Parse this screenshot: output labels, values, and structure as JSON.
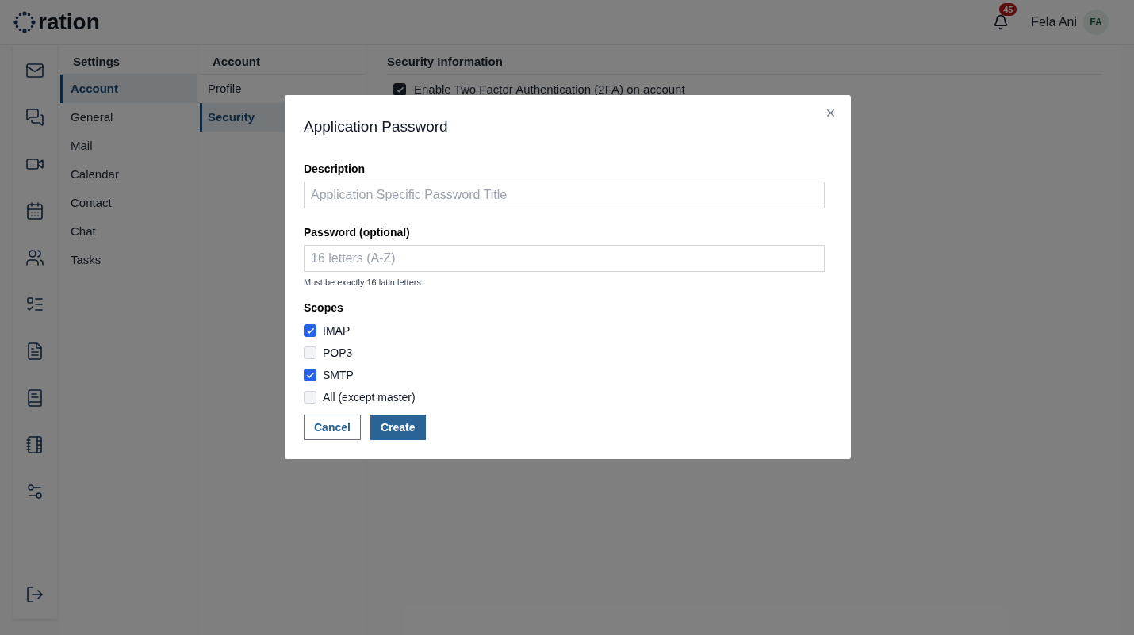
{
  "header": {
    "logo_text": "ration",
    "notifications": {
      "count": "45"
    },
    "user": {
      "name": "Fela Ani",
      "initials": "FA"
    }
  },
  "settings_menu": {
    "title": "Settings",
    "items": [
      {
        "label": "Account",
        "selected": true
      },
      {
        "label": "General",
        "selected": false
      },
      {
        "label": "Mail",
        "selected": false
      },
      {
        "label": "Calendar",
        "selected": false
      },
      {
        "label": "Contact",
        "selected": false
      },
      {
        "label": "Chat",
        "selected": false
      },
      {
        "label": "Tasks",
        "selected": false
      }
    ]
  },
  "account_menu": {
    "title": "Account",
    "items": [
      {
        "label": "Profile",
        "selected": false
      },
      {
        "label": "Security",
        "selected": true
      }
    ]
  },
  "security": {
    "title": "Security Information",
    "two_factor": {
      "label": "Enable Two Factor Authentication (2FA) on account",
      "checked": true
    }
  },
  "dialog": {
    "title": "Application Password",
    "fields": [
      {
        "label": "Description",
        "placeholder": "Application Specific Password Title"
      },
      {
        "label": "Password (optional)",
        "placeholder": "16 letters (A-Z)",
        "hint": "Must be exactly 16 latin letters."
      }
    ],
    "scopes": {
      "label": "Scopes",
      "items": [
        {
          "label": "IMAP",
          "checked": true
        },
        {
          "label": "POP3",
          "checked": false
        },
        {
          "label": "SMTP",
          "checked": true
        },
        {
          "label": "All (except master)",
          "checked": false
        }
      ]
    },
    "buttons": [
      {
        "label": "Cancel",
        "kind": "secondary"
      },
      {
        "label": "Create",
        "kind": "primary"
      }
    ]
  }
}
